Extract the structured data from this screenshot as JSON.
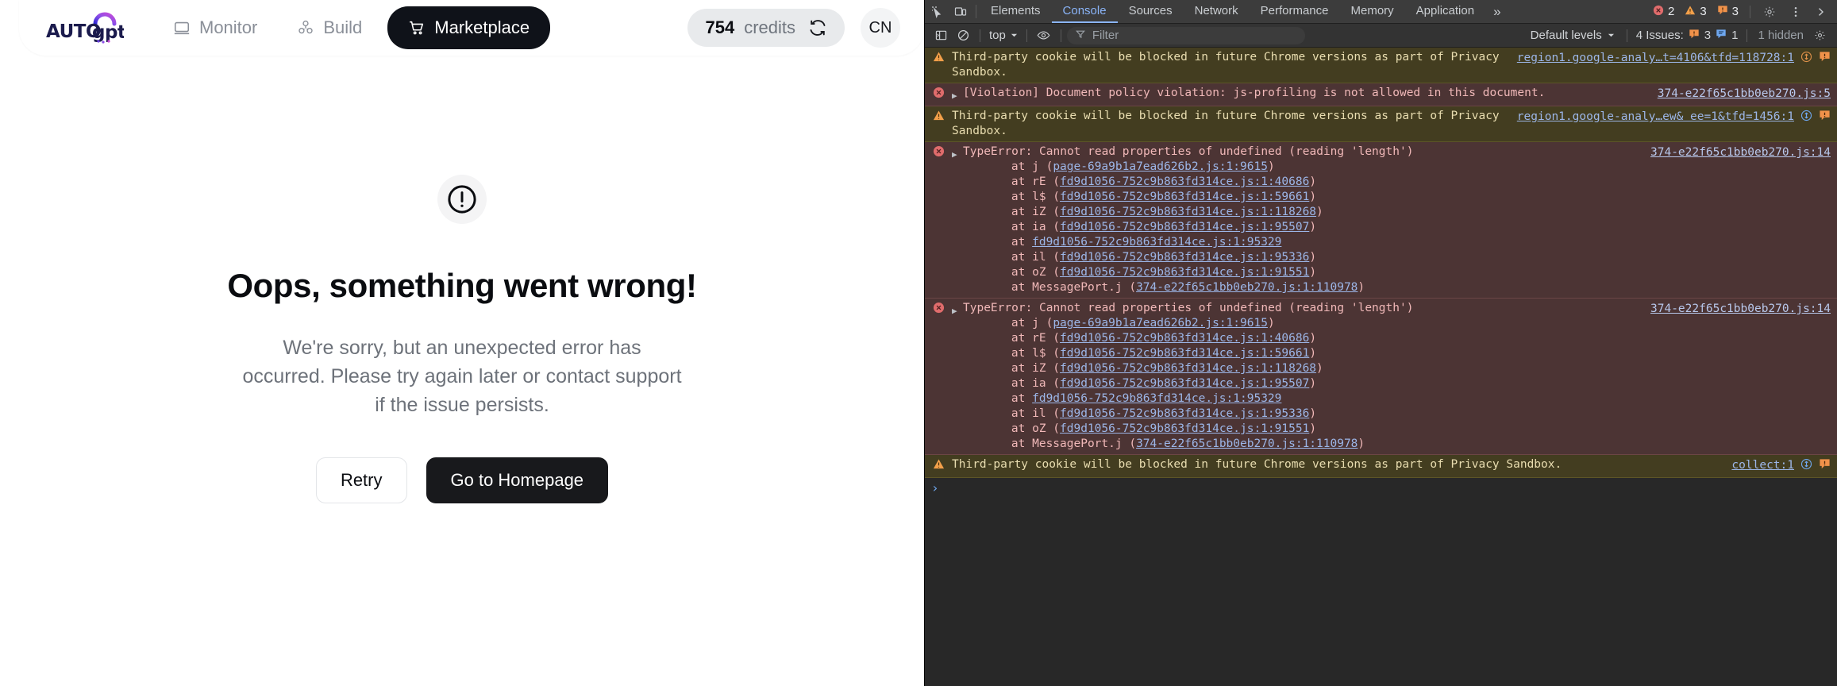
{
  "app": {
    "brand_name": "AutoGPT",
    "nav": [
      {
        "label": "Monitor",
        "icon": "monitor-icon",
        "active": false
      },
      {
        "label": "Build",
        "icon": "build-blocks-icon",
        "active": false
      },
      {
        "label": "Marketplace",
        "icon": "shopping-cart-icon",
        "active": true
      }
    ],
    "credits": {
      "value": "754",
      "label": "credits",
      "refresh_icon": "refresh-icon"
    },
    "avatar": {
      "initials": "CN"
    }
  },
  "error_page": {
    "icon": "exclamation-circle-icon",
    "title": "Oops, something went wrong!",
    "body": "We're sorry, but an unexpected error has occurred. Please try again later or contact support if the issue persists.",
    "buttons": {
      "retry": "Retry",
      "home": "Go to Homepage"
    }
  },
  "devtools": {
    "toolbar": {
      "inspect_icon": "inspect-element-icon",
      "device_icon": "device-toolbar-icon",
      "tabs": [
        {
          "label": "Elements",
          "selected": false
        },
        {
          "label": "Console",
          "selected": true
        },
        {
          "label": "Sources",
          "selected": false
        },
        {
          "label": "Network",
          "selected": false
        },
        {
          "label": "Performance",
          "selected": false
        },
        {
          "label": "Memory",
          "selected": false
        },
        {
          "label": "Application",
          "selected": false
        }
      ],
      "more_tabs": "»",
      "counts": {
        "errors": "2",
        "warnings": "3",
        "issues": "3"
      },
      "settings_icon": "gear-icon",
      "kebab_icon": "more-vertical-icon",
      "close_icon": "close-icon"
    },
    "filterbar": {
      "sidebar_icon": "console-sidebar-icon",
      "clear_icon": "clear-console-icon",
      "context": "top",
      "eye_icon": "live-expression-eye-icon",
      "filter_placeholder": "Filter",
      "filter_value": "",
      "levels": "Default levels",
      "issues_label": "4 Issues:",
      "issues_orange": "3",
      "issues_blue": "1",
      "hidden_label": "1 hidden",
      "settings_icon": "console-settings-gear-icon"
    },
    "messages": [
      {
        "kind": "warn",
        "text": "Third-party cookie will be blocked in future Chrome versions as part of Privacy Sandbox.",
        "source": "region1.google-analy…t=4106&tfd=118728:1",
        "badges": [
          "cookie-issue-icon",
          "issue-marker-icon"
        ],
        "expandable": false
      },
      {
        "kind": "err",
        "text": "[Violation] Document policy violation: js-profiling is not allowed in this document.",
        "source": "374-e22f65c1bb0eb270.js:5",
        "badges": [],
        "expandable": true
      },
      {
        "kind": "warn",
        "text": "Third-party cookie will be blocked in future Chrome versions as part of Privacy Sandbox.",
        "source": "region1.google-analy…ew& ee=1&tfd=1456:1",
        "badges": [
          "cookie-issue-icon",
          "issue-marker-icon"
        ],
        "expandable": false
      },
      {
        "kind": "err",
        "text": "TypeError: Cannot read properties of undefined (reading 'length')",
        "source": "374-e22f65c1bb0eb270.js:14",
        "expandable": true,
        "badges": [],
        "stack": [
          {
            "prefix": "    at j (",
            "link": "page-69a9b1a7ead626b2.js:1:9615",
            "suffix": ")"
          },
          {
            "prefix": "    at rE (",
            "link": "fd9d1056-752c9b863fd314ce.js:1:40686",
            "suffix": ")"
          },
          {
            "prefix": "    at l$ (",
            "link": "fd9d1056-752c9b863fd314ce.js:1:59661",
            "suffix": ")"
          },
          {
            "prefix": "    at iZ (",
            "link": "fd9d1056-752c9b863fd314ce.js:1:118268",
            "suffix": ")"
          },
          {
            "prefix": "    at ia (",
            "link": "fd9d1056-752c9b863fd314ce.js:1:95507",
            "suffix": ")"
          },
          {
            "prefix": "    at ",
            "link": "fd9d1056-752c9b863fd314ce.js:1:95329",
            "suffix": ""
          },
          {
            "prefix": "    at il (",
            "link": "fd9d1056-752c9b863fd314ce.js:1:95336",
            "suffix": ")"
          },
          {
            "prefix": "    at oZ (",
            "link": "fd9d1056-752c9b863fd314ce.js:1:91551",
            "suffix": ")"
          },
          {
            "prefix": "    at MessagePort.j (",
            "link": "374-e22f65c1bb0eb270.js:1:110978",
            "suffix": ")"
          }
        ]
      },
      {
        "kind": "err",
        "text": "TypeError: Cannot read properties of undefined (reading 'length')",
        "source": "374-e22f65c1bb0eb270.js:14",
        "expandable": true,
        "badges": [],
        "stack": [
          {
            "prefix": "    at j (",
            "link": "page-69a9b1a7ead626b2.js:1:9615",
            "suffix": ")"
          },
          {
            "prefix": "    at rE (",
            "link": "fd9d1056-752c9b863fd314ce.js:1:40686",
            "suffix": ")"
          },
          {
            "prefix": "    at l$ (",
            "link": "fd9d1056-752c9b863fd314ce.js:1:59661",
            "suffix": ")"
          },
          {
            "prefix": "    at iZ (",
            "link": "fd9d1056-752c9b863fd314ce.js:1:118268",
            "suffix": ")"
          },
          {
            "prefix": "    at ia (",
            "link": "fd9d1056-752c9b863fd314ce.js:1:95507",
            "suffix": ")"
          },
          {
            "prefix": "    at ",
            "link": "fd9d1056-752c9b863fd314ce.js:1:95329",
            "suffix": ""
          },
          {
            "prefix": "    at il (",
            "link": "fd9d1056-752c9b863fd314ce.js:1:95336",
            "suffix": ")"
          },
          {
            "prefix": "    at oZ (",
            "link": "fd9d1056-752c9b863fd314ce.js:1:91551",
            "suffix": ")"
          },
          {
            "prefix": "    at MessagePort.j (",
            "link": "374-e22f65c1bb0eb270.js:1:110978",
            "suffix": ")"
          }
        ]
      },
      {
        "kind": "warn",
        "text": "Third-party cookie will be blocked in future Chrome versions as part of Privacy Sandbox.",
        "source": "collect:1",
        "badges": [
          "cookie-issue-icon",
          "issue-marker-icon"
        ],
        "expandable": false
      }
    ],
    "prompt_caret": "›"
  },
  "colors": {
    "accent_blue": "#8ab4f8",
    "warn_bg": "#433d20",
    "error_bg": "#4c3434",
    "dark_button": "#18191c"
  }
}
